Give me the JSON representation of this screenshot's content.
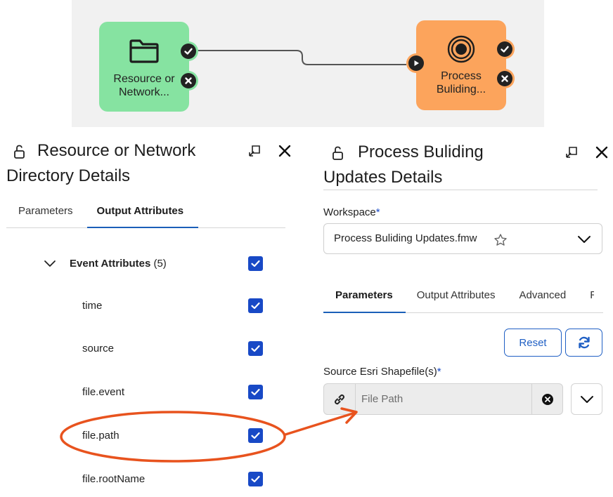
{
  "canvas": {
    "source_node": {
      "label_line1": "Resource or",
      "label_line2": "Network..."
    },
    "target_node": {
      "label_line1": "Process",
      "label_line2": "Buliding..."
    }
  },
  "left_panel": {
    "title_line1": "Resource or Network",
    "title_line2": "Directory Details",
    "tabs": [
      "Parameters",
      "Output Attributes"
    ],
    "active_tab": "Output Attributes",
    "group": {
      "label": "Event Attributes",
      "count": "(5)",
      "checked": true
    },
    "attributes": [
      {
        "name": "time",
        "checked": true
      },
      {
        "name": "source",
        "checked": true
      },
      {
        "name": "file.event",
        "checked": true
      },
      {
        "name": "file.path",
        "checked": true
      },
      {
        "name": "file.rootName",
        "checked": true
      }
    ]
  },
  "right_panel": {
    "title_line1": "Process Buliding",
    "title_line2": "Updates Details",
    "workspace_label": "Workspace",
    "required_mark": "*",
    "workspace_value": "Process Buliding Updates.fmw",
    "tabs": [
      "Parameters",
      "Output Attributes",
      "Advanced",
      "R"
    ],
    "active_tab": "Parameters",
    "reset_label": "Reset",
    "source_label": "Source Esri Shapefile(s)",
    "file_path_placeholder": "File Path"
  },
  "colors": {
    "source_node": "#86e3a1",
    "target_node": "#fca45c",
    "accent": "#1849c6",
    "annotation": "#e8531e"
  }
}
